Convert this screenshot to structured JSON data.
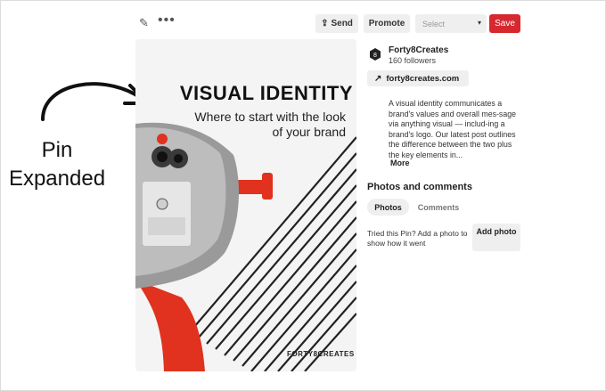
{
  "annotation": {
    "line1": "Pin",
    "line2": "Expanded"
  },
  "toolbar": {
    "edit_icon": "pencil-icon",
    "more_icon": "ellipsis-icon",
    "send_label": "Send",
    "promote_label": "Promote",
    "board_select_value": "Select",
    "save_label": "Save"
  },
  "pin": {
    "title": "VISUAL IDENTITY",
    "subtitle": "Where to start with the look of your brand",
    "brand": "FORTY8CREATES"
  },
  "profile": {
    "name": "Forty8Creates",
    "followers": "160 followers",
    "link": "forty8creates.com"
  },
  "description": {
    "text": "A visual identity communicates a brand's values and overall mes-sage via anything visual — includ-ing a brand's logo. Our latest post outlines the difference between the two plus the key elements in...",
    "more": "More"
  },
  "photos_comments": {
    "heading": "Photos and comments",
    "tabs": [
      "Photos",
      "Comments"
    ],
    "prompt": "Tried this Pin? Add a photo to show how it went",
    "add_button": "Add photo"
  },
  "colors": {
    "save_red": "#d7282f",
    "viewer_red": "#e0321e",
    "button_gray": "#efefef"
  }
}
